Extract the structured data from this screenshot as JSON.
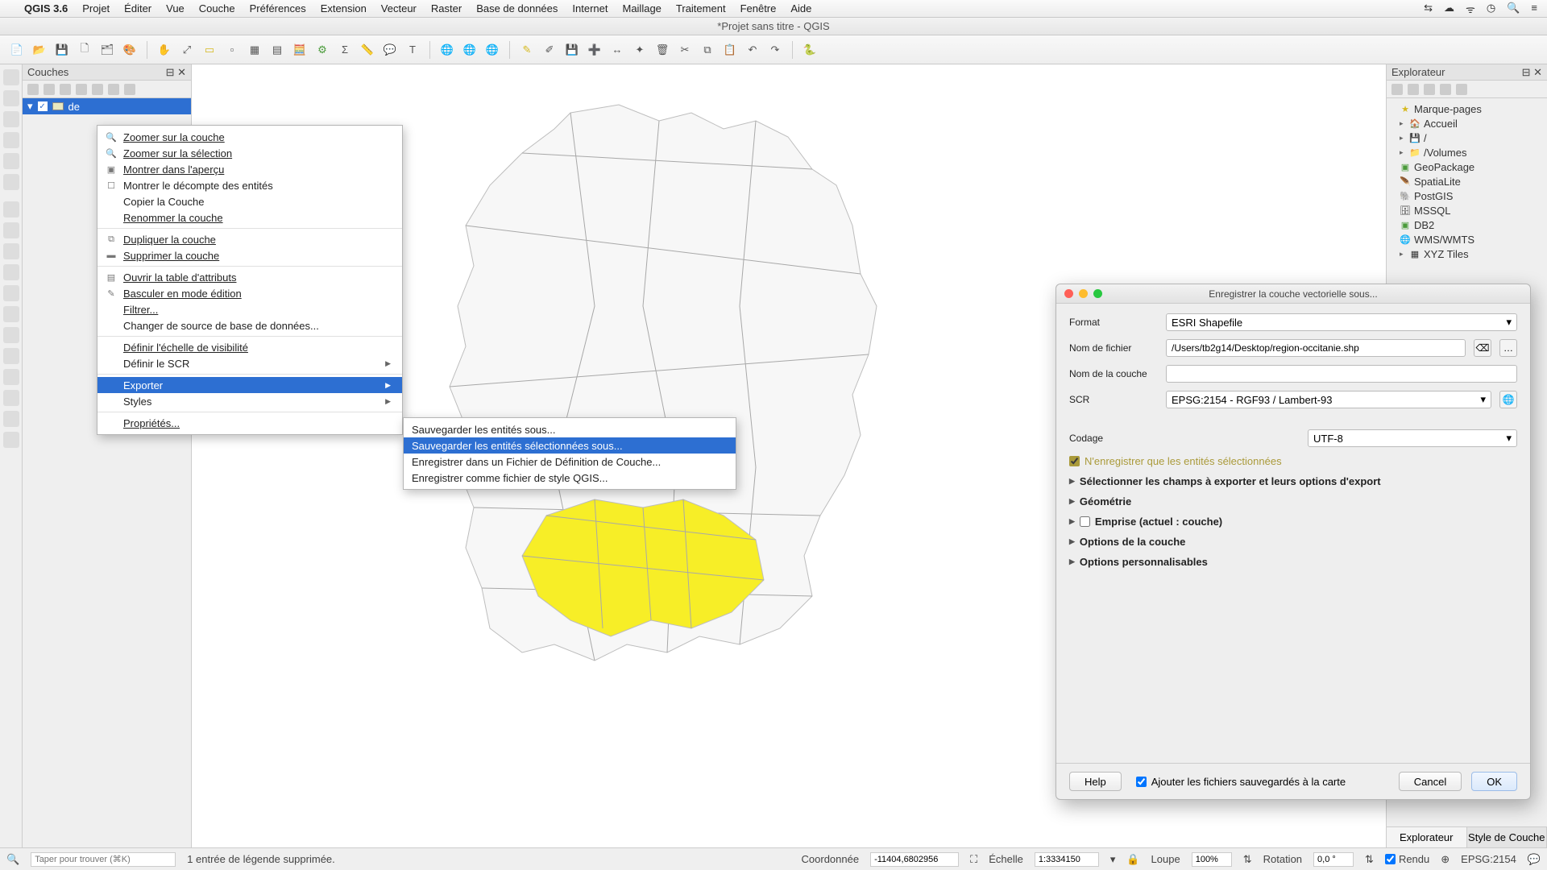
{
  "mac_menu": {
    "app": "QGIS 3.6",
    "items": [
      "Projet",
      "Éditer",
      "Vue",
      "Couche",
      "Préférences",
      "Extension",
      "Vecteur",
      "Raster",
      "Base de données",
      "Internet",
      "Maillage",
      "Traitement",
      "Fenêtre",
      "Aide"
    ]
  },
  "window_title": "*Projet sans titre - QGIS",
  "layers_panel": {
    "title": "Couches",
    "layer_name": "de"
  },
  "context_menu": {
    "zoom_layer": "Zoomer sur la couche",
    "zoom_selection": "Zoomer sur la sélection",
    "show_overview": "Montrer dans l'aperçu",
    "show_count": "Montrer le décompte des entités",
    "copy_layer": "Copier la Couche",
    "rename_layer": "Renommer la couche",
    "duplicate": "Dupliquer la couche",
    "remove": "Supprimer la couche",
    "open_table": "Ouvrir la table d'attributs",
    "toggle_edit": "Basculer en mode édition",
    "filter": "Filtrer...",
    "change_source": "Changer de source de base de données...",
    "def_visibility": "Définir l'échelle de visibilité",
    "def_scr": "Définir le SCR",
    "export": "Exporter",
    "styles": "Styles",
    "properties": "Propriétés..."
  },
  "export_submenu": {
    "save_features": "Sauvegarder les entités sous...",
    "save_selected": "Sauvegarder les entités sélectionnées sous...",
    "save_layerdef": "Enregistrer dans un Fichier de Définition de Couche...",
    "save_style": "Enregistrer comme fichier de style QGIS..."
  },
  "browser": {
    "title": "Explorateur",
    "items": [
      "Marque-pages",
      "Accueil",
      "/",
      "/Volumes",
      "GeoPackage",
      "SpatiaLite",
      "PostGIS",
      "MSSQL",
      "DB2",
      "WMS/WMTS",
      "XYZ Tiles"
    ],
    "tabs": [
      "Explorateur",
      "Style de Couche"
    ]
  },
  "save_dialog": {
    "title": "Enregistrer la couche vectorielle sous...",
    "format_label": "Format",
    "format_value": "ESRI Shapefile",
    "filename_label": "Nom de fichier",
    "filename_value": "/Users/tb2g14/Desktop/region-occitanie.shp",
    "layername_label": "Nom de la couche",
    "layername_value": "",
    "scr_label": "SCR",
    "scr_value": "EPSG:2154 - RGF93 / Lambert-93",
    "encoding_label": "Codage",
    "encoding_value": "UTF-8",
    "only_selected": "N'enregistrer que les entités sélectionnées",
    "select_fields": "Sélectionner les champs à exporter et leurs options d'export",
    "geometry": "Géométrie",
    "extent": "Emprise (actuel : couche)",
    "layer_options": "Options de la couche",
    "custom_options": "Options personnalisables",
    "add_saved": "Ajouter les fichiers sauvegardés à la carte",
    "help": "Help",
    "cancel": "Cancel",
    "ok": "OK"
  },
  "statusbar": {
    "search_placeholder": "Taper pour trouver (⌘K)",
    "legend_msg": "1 entrée de légende supprimée.",
    "coord_label": "Coordonnée",
    "coord_value": "-11404,6802956",
    "scale_label": "Échelle",
    "scale_value": "1:3334150",
    "lupe_label": "Loupe",
    "lupe_value": "100%",
    "rotation_label": "Rotation",
    "rotation_value": "0,0 °",
    "render_label": "Rendu",
    "epsg": "EPSG:2154"
  }
}
